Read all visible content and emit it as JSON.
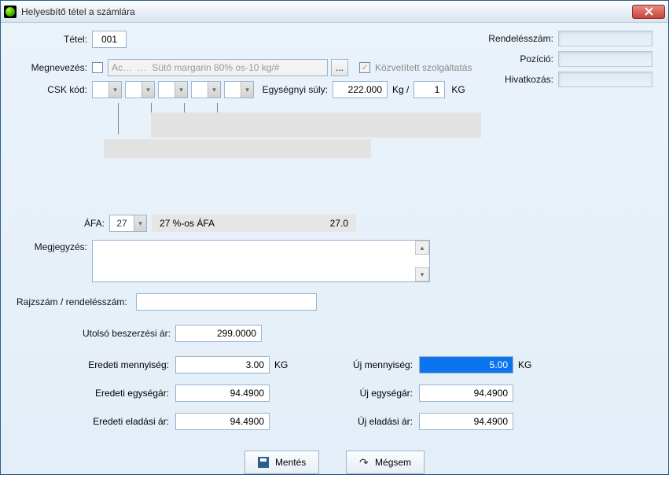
{
  "window": {
    "title": "Helyesbítő tétel a számlára"
  },
  "top_right": {
    "order_label": "Rendelésszám:",
    "position_label": "Pozíció:",
    "reference_label": "Hivatkozás:"
  },
  "labels": {
    "tetel": "Tétel:",
    "megnevezes": "Megnevezés:",
    "kozvetitett": "Közvetített szolgáltatás",
    "csk": "CSK kód:",
    "egysuly": "Egységnyi súly:",
    "kgper": "Kg /",
    "kg": "KG",
    "afa": "ÁFA:",
    "afa_desc": "27 %-os ÁFA",
    "afa_val": "27.0",
    "megjegyzes": "Megjegyzés:",
    "rajzszam": "Rajzszám / rendelésszám:",
    "utolso": "Utolsó beszerzési ár:",
    "eredeti_mny": "Eredeti mennyiség:",
    "eredeti_ear": "Eredeti egységár:",
    "eredeti_elad": "Eredeti eladási ár:",
    "uj_mny": "Új mennyiség:",
    "uj_ear": "Új egységár:",
    "uj_elad": "Új eladási ár:"
  },
  "values": {
    "tetel": "001",
    "megnevezes": "Ac…  …  Sütő margarin 80% os-10 kg/#",
    "egysuly": "222.000",
    "egysuly_per": "1",
    "afa_sel": "27",
    "utolso": "299.0000",
    "eredeti_mny": "3.00",
    "eredeti_ear": "94.4900",
    "eredeti_elad": "94.4900",
    "uj_mny": "5.00",
    "uj_ear": "94.4900",
    "uj_elad": "94.4900"
  },
  "buttons": {
    "mentes": "Mentés",
    "megsem": "Mégsem",
    "ellipsis": "..."
  }
}
